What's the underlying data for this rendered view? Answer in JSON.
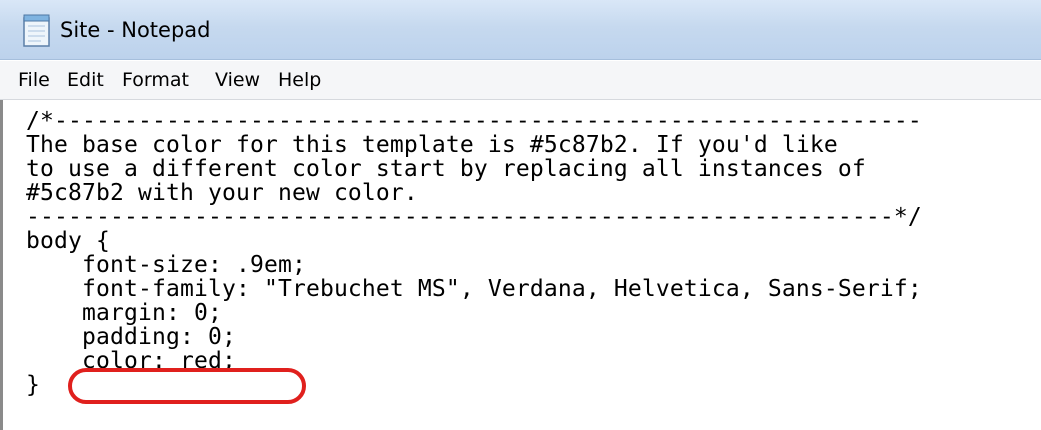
{
  "window": {
    "title": "Site - Notepad",
    "icon": "notepad-icon"
  },
  "menu": {
    "items": [
      "File",
      "Edit",
      "Format",
      "View",
      "Help"
    ]
  },
  "editor": {
    "lines": [
      "/*--------------------------------------------------------------",
      "The base color for this template is #5c87b2. If you'd like",
      "to use a different color start by replacing all instances of",
      "#5c87b2 with your new color.",
      "--------------------------------------------------------------*/",
      "body {",
      "    font-size: .9em;",
      "    font-family: \"Trebuchet MS\", Verdana, Helvetica, Sans-Serif;",
      "    margin: 0;",
      "    padding: 0;",
      "    color: red;",
      "}"
    ]
  },
  "annotation": {
    "highlight_color": "#e0201d",
    "highlighted_line": "    color: red;"
  }
}
